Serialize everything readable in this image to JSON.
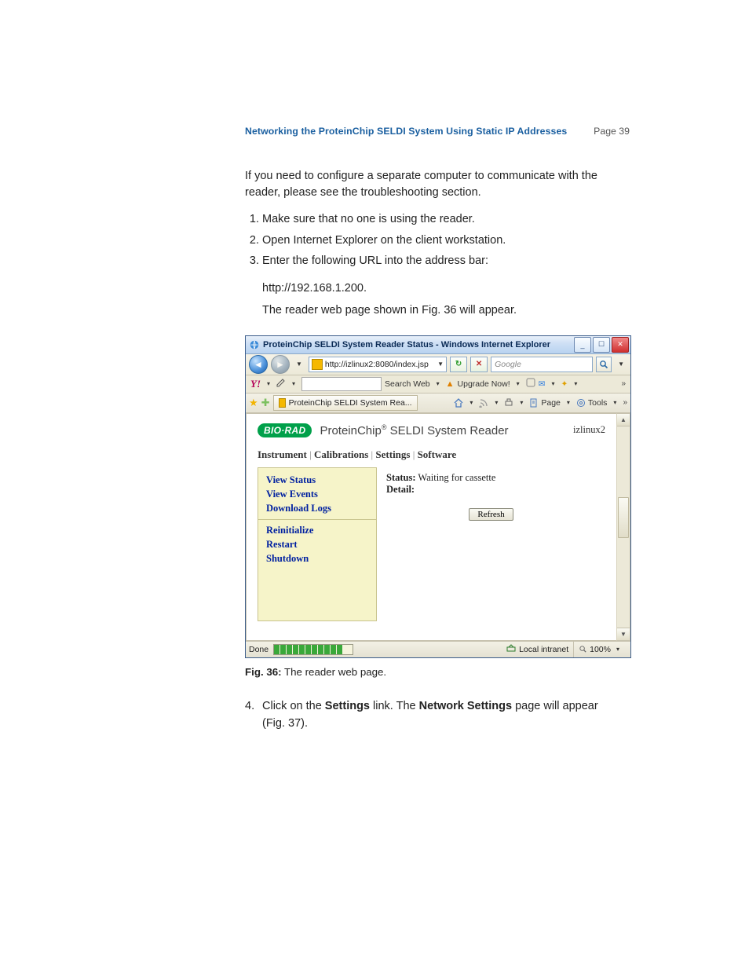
{
  "header": {
    "title": "Networking the ProteinChip SELDI System Using Static IP Addresses",
    "page": "Page 39"
  },
  "body": {
    "intro": "If you need to configure a separate computer to communicate with the reader, please see the troubleshooting section.",
    "steps": [
      "Make sure that no one is using the reader.",
      "Open Internet Explorer on the client workstation.",
      "Enter the following URL into the address bar:"
    ],
    "step3_url": "http://192.168.1.200.",
    "step3_result": "The reader web page shown in Fig. 36 will appear.",
    "fig_label": "Fig. 36:",
    "fig_text": " The reader web page.",
    "step4_num": "4.",
    "step4_a": "Click on the ",
    "step4_b1": "Settings",
    "step4_c": " link. The ",
    "step4_b2": "Network Settings",
    "step4_d": " page will appear",
    "step4_e": "(Fig. 37)."
  },
  "ie": {
    "title": "ProteinChip SELDI System Reader Status - Windows Internet Explorer",
    "url": "http://izlinux2:8080/index.jsp",
    "search_placeholder": "Google",
    "tab_title": "ProteinChip SELDI System Rea...",
    "yahoo": {
      "logo": "Y!",
      "search_web": "Search Web",
      "upgrade": "Upgrade Now!"
    },
    "cmd": {
      "page": "Page",
      "tools": "Tools"
    },
    "status": "Done",
    "zone": "Local intranet",
    "zoom": "100%"
  },
  "reader": {
    "brand": "BIO·RAD",
    "title_tail": "SELDI System Reader",
    "host": "izlinux2",
    "tabs": [
      "Instrument",
      "Calibrations",
      "Settings",
      "Software"
    ],
    "side": [
      "View Status",
      "View Events",
      "Download Logs",
      "Reinitialize",
      "Restart",
      "Shutdown"
    ],
    "status_lbl": "Status:",
    "status_val": "Waiting for cassette",
    "detail_lbl": "Detail:",
    "refresh": "Refresh"
  }
}
